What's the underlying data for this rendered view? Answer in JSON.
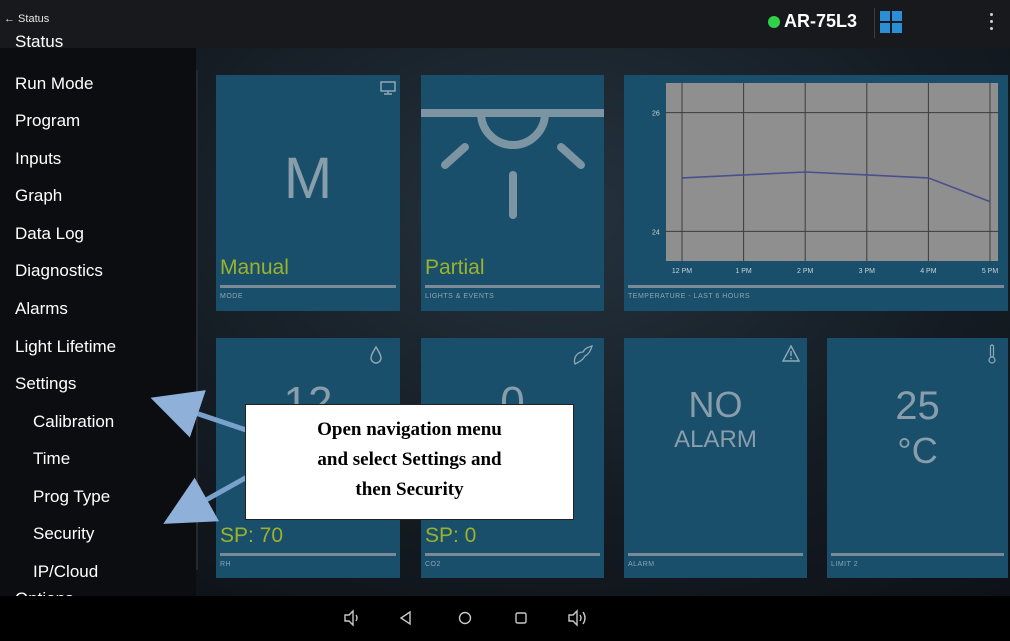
{
  "topbar": {
    "back_label": "← Status",
    "device_name": "AR-75L3",
    "status_color": "#2fd24a"
  },
  "sidebar": {
    "partial_top": "Status",
    "items": [
      "Run Mode",
      "Program",
      "Inputs",
      "Graph",
      "Data Log",
      "Diagnostics",
      "Alarms",
      "Light Lifetime",
      "Settings"
    ],
    "sub_items": [
      "Calibration",
      "Time",
      "Prog Type",
      "Security",
      "IP/Cloud"
    ],
    "partial_bottom": "Options"
  },
  "tiles": {
    "mode": {
      "big": "M",
      "status": "Manual",
      "caption": "MODE",
      "icon": "monitor-icon"
    },
    "lights": {
      "status": "Partial",
      "caption": "LIGHTS & EVENTS",
      "icon": "light-fixture-icon"
    },
    "temperature_chart": {
      "caption": "TEMPERATURE - LAST 6 HOURS",
      "y_ticks": [
        "26",
        "24"
      ],
      "x_ticks": [
        "12 PM",
        "1 PM",
        "2 PM",
        "3 PM",
        "4 PM",
        "5 PM"
      ]
    },
    "rh": {
      "big": "12",
      "status": "SP: 70",
      "caption": "RH",
      "icon": "droplet-icon"
    },
    "co2": {
      "big": "0",
      "status": "SP: 0",
      "caption": "CO2",
      "icon": "co2-icon"
    },
    "alarm": {
      "big1": "NO",
      "big2": "ALARM",
      "caption": "ALARM",
      "icon": "warning-icon"
    },
    "limit": {
      "big1": "25",
      "big2": "°C",
      "caption": "LIMIT 2",
      "icon": "thermometer-icon"
    }
  },
  "chart_data": {
    "type": "line",
    "x": [
      "12 PM",
      "1 PM",
      "2 PM",
      "3 PM",
      "4 PM",
      "5 PM"
    ],
    "series": [
      {
        "values": [
          24.9,
          24.95,
          25.0,
          24.95,
          24.9,
          24.5
        ]
      }
    ],
    "ylim": [
      23.5,
      26.5
    ],
    "grid": true,
    "xlabel": "TEMPERATURE - LAST 6 HOURS"
  },
  "callout": {
    "lines": [
      "Open navigation menu",
      "and select Settings and",
      "then Security"
    ]
  },
  "colors": {
    "tile": "#1a4f6b",
    "status_text": "#9bb22a",
    "arrow": "#7aa0cc"
  }
}
